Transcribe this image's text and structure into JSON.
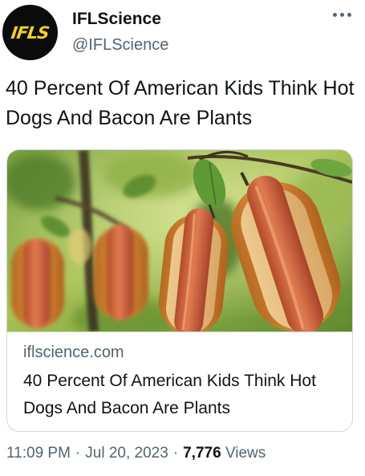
{
  "author": {
    "avatar_text": "IFLS",
    "display_name": "IFLScience",
    "handle": "@IFLScience",
    "avatar_icon": "ifls-logo",
    "more_icon": "more-horizontal-icon"
  },
  "tweet": {
    "text": "40 Percent Of American Kids Think Hot Dogs And Bacon Are Plants"
  },
  "card": {
    "image": "hot-dogs-growing-on-tree-photo",
    "domain": "iflscience.com",
    "title": "40 Percent Of American Kids Think Hot Dogs And Bacon Are Plants"
  },
  "footer": {
    "time": "11:09 PM",
    "date": "Jul 20, 2023",
    "views_count": "7,776",
    "views_label": "Views"
  },
  "colors": {
    "text_primary": "#0f1419",
    "text_secondary": "#536471",
    "border": "#cfd9de",
    "avatar_bg": "#0b0b0b",
    "avatar_text": "#f6d11b"
  }
}
